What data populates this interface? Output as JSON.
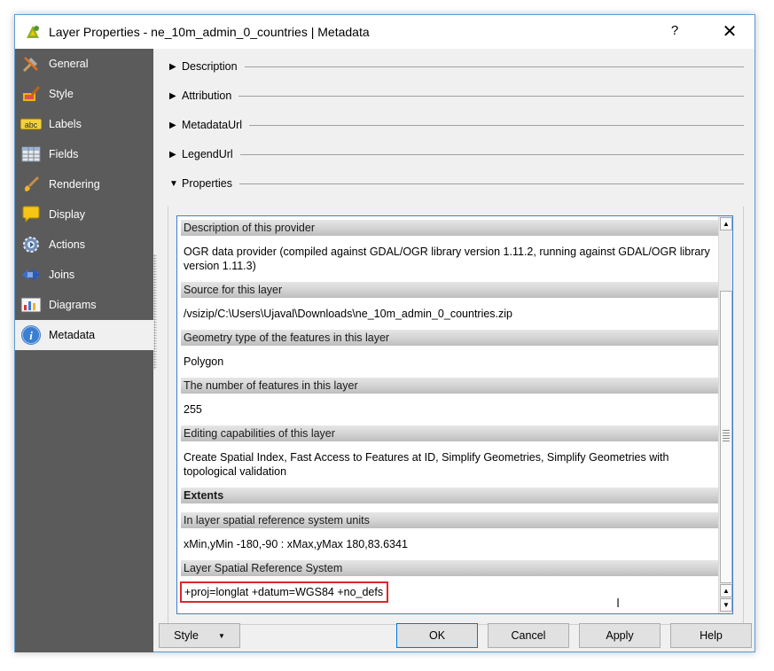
{
  "window": {
    "title": "Layer Properties - ne_10m_admin_0_countries | Metadata",
    "help_label": "?",
    "close_label": "✕"
  },
  "sidebar": {
    "items": [
      {
        "label": "General",
        "icon": "general-tools-icon"
      },
      {
        "label": "Style",
        "icon": "style-brush-icon"
      },
      {
        "label": "Labels",
        "icon": "labels-abc-icon"
      },
      {
        "label": "Fields",
        "icon": "fields-table-icon"
      },
      {
        "label": "Rendering",
        "icon": "rendering-brush-icon"
      },
      {
        "label": "Display",
        "icon": "display-bubble-icon"
      },
      {
        "label": "Actions",
        "icon": "actions-gear-icon"
      },
      {
        "label": "Joins",
        "icon": "joins-icon"
      },
      {
        "label": "Diagrams",
        "icon": "diagrams-icon"
      },
      {
        "label": "Metadata",
        "icon": "info-icon"
      }
    ],
    "active": "Metadata"
  },
  "sections": {
    "description": "Description",
    "attribution": "Attribution",
    "metadataurl": "MetadataUrl",
    "legendurl": "LegendUrl",
    "properties": "Properties"
  },
  "metadata": {
    "provider_header": "Description of this provider",
    "provider_value": "OGR data provider (compiled against GDAL/OGR library version 1.11.2, running against GDAL/OGR library version 1.11.3)",
    "source_header": "Source for this layer",
    "source_value": "/vsizip/C:\\Users\\Ujaval\\Downloads\\ne_10m_admin_0_countries.zip",
    "geometry_header": "Geometry type of the features in this layer",
    "geometry_value": "Polygon",
    "count_header": "The number of features in this layer",
    "count_value": "255",
    "editing_header": "Editing capabilities of this layer",
    "editing_value": "Create Spatial Index, Fast Access to Features at ID, Simplify Geometries, Simplify Geometries with topological validation",
    "extents_header": "Extents",
    "units_header": "In layer spatial reference system units",
    "units_value": "xMin,yMin -180,-90 : xMax,yMax 180,83.6341",
    "srs_header": "Layer Spatial Reference System",
    "srs_value": "+proj=longlat +datum=WGS84 +no_defs"
  },
  "buttons": {
    "style": "Style",
    "ok": "OK",
    "cancel": "Cancel",
    "apply": "Apply",
    "help": "Help"
  },
  "colors": {
    "sidebar_bg": "#5b5b5b",
    "highlight_border": "#e0262c",
    "focus_border": "#3c7fd0"
  }
}
